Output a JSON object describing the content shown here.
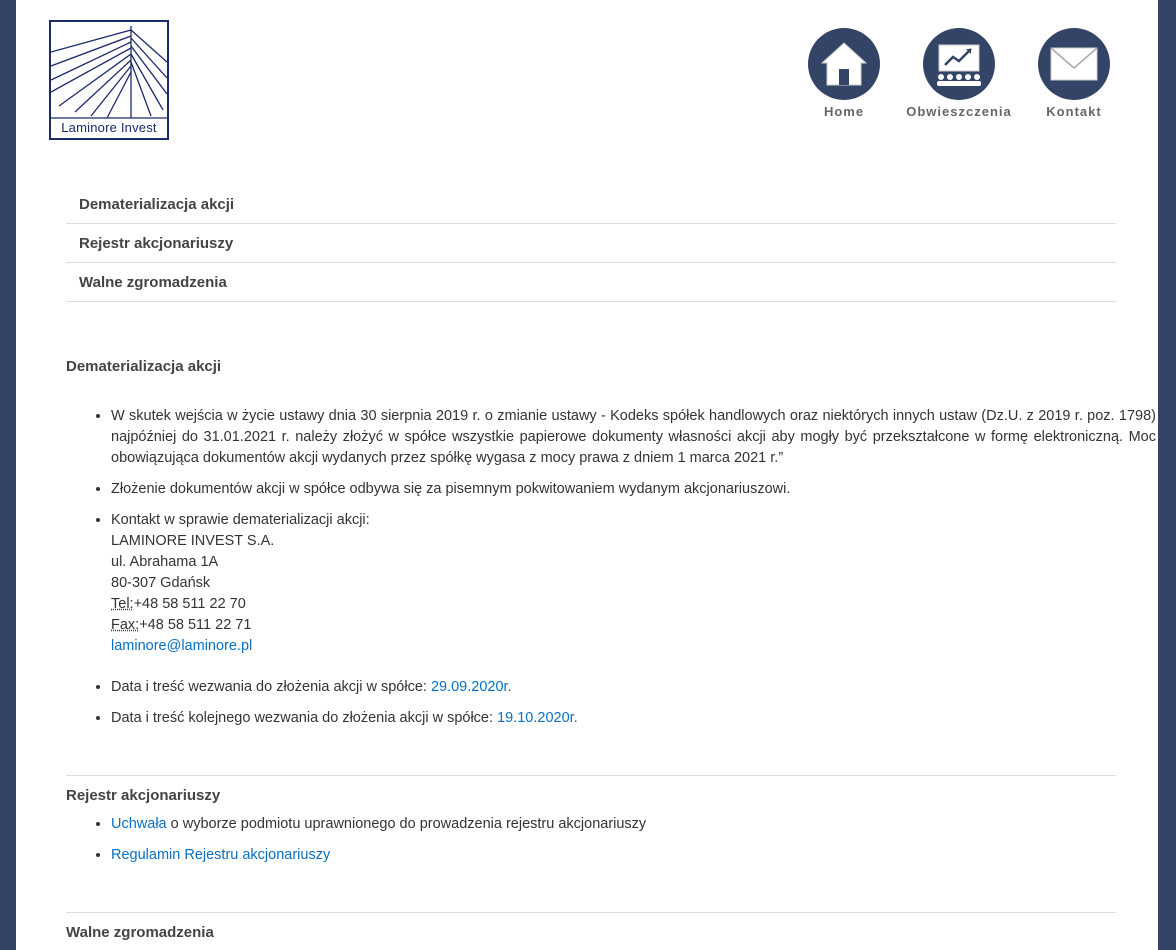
{
  "logo": {
    "text": "Laminore Invest"
  },
  "nav": [
    {
      "label": "Home",
      "icon": "house-icon"
    },
    {
      "label": "Obwieszczenia",
      "icon": "presentation-chart-icon"
    },
    {
      "label": "Kontakt",
      "icon": "envelope-icon"
    }
  ],
  "accordion": [
    {
      "label": "Dematerializacja akcji"
    },
    {
      "label": "Rejestr akcjonariuszy"
    },
    {
      "label": "Walne zgromadzenia"
    }
  ],
  "sections": {
    "dematerializacja": {
      "title": "Dematerializacja akcji",
      "item1": "W skutek wejścia w życie ustawy dnia 30 sierpnia 2019 r. o zmianie ustawy - Kodeks spółek handlowych oraz niektórych innych ustaw (Dz.U. z 2019 r. poz. 1798) najpóźniej do 31.01.2021 r. należy złożyć w spółce wszystkie papierowe dokumenty własności akcji aby mogły być przekształcone w formę elektroniczną. Moc obowiązująca dokumentów akcji wydanych przez spółkę wygasa z mocy prawa z dniem 1 marca 2021 r.”",
      "item2": "Złożenie dokumentów akcji w spółce odbywa się za pisemnym pokwitowaniem wydanym akcjonariuszowi.",
      "contact": {
        "intro": "Kontakt w sprawie dematerializacji akcji:",
        "company": "LAMINORE INVEST S.A.",
        "street": "ul. Abrahama 1A",
        "city": "80-307 Gdańsk",
        "tel_label": "Tel:",
        "tel": "+48 58 511 22 70",
        "fax_label": "Fax:",
        "fax": "+48 58 511 22 71",
        "email": "laminore@laminore.pl"
      },
      "item4_text": "Data i treść wezwania do złożenia akcji w spółce: ",
      "item4_link": "29.09.2020r.",
      "item5_text": "Data i treść kolejnego wezwania do złożenia akcji w spółce: ",
      "item5_link": "19.10.2020r."
    },
    "rejestr": {
      "title": "Rejestr akcjonariuszy",
      "item1_link": "Uchwała",
      "item1_text": " o wyborze podmiotu uprawnionego do prowadzenia rejestru akcjonariuszy",
      "item2_link": "Regulamin Rejestru akcjonariuszy"
    },
    "walne": {
      "title": "Walne zgromadzenia"
    }
  },
  "colors": {
    "frame": "#334466",
    "link": "#0a6fc2",
    "logo": "#1b2a6b"
  }
}
